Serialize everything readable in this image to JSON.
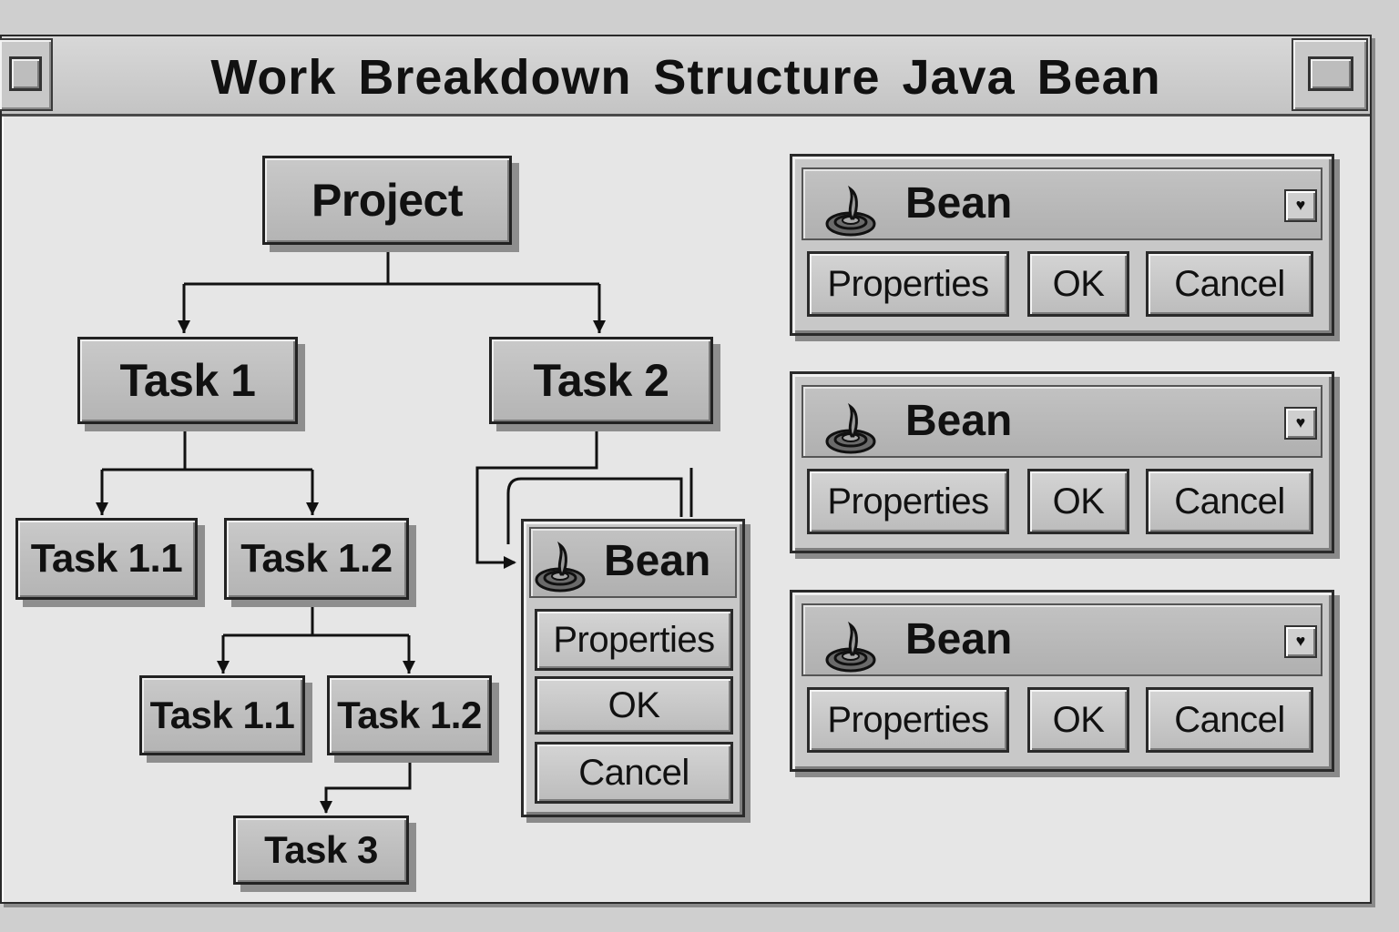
{
  "window": {
    "title": "Work Breakdown Structure Java Bean"
  },
  "tree": {
    "project": "Project",
    "task1": "Task 1",
    "task2": "Task 2",
    "task1_1": "Task 1.1",
    "task1_2": "Task 1.2",
    "task1_2_1": "Task 1.1",
    "task1_2_2": "Task 1.2",
    "task3": "Task 3"
  },
  "inline_bean": {
    "title": "Bean",
    "icon": "java-bean-icon",
    "buttons": [
      "Properties",
      "OK",
      "Cancel"
    ]
  },
  "bean_panels": [
    {
      "title": "Bean",
      "icon": "java-bean-icon",
      "dropdown_icon": "heart-dropdown-icon",
      "buttons": [
        "Properties",
        "OK",
        "Cancel"
      ]
    },
    {
      "title": "Bean",
      "icon": "java-bean-icon",
      "dropdown_icon": "heart-dropdown-icon",
      "buttons": [
        "Properties",
        "OK",
        "Cancel"
      ]
    },
    {
      "title": "Bean",
      "icon": "java-bean-icon",
      "dropdown_icon": "heart-dropdown-icon",
      "buttons": [
        "Properties",
        "OK",
        "Cancel"
      ]
    }
  ],
  "colors": {
    "background": "#e6e6e6",
    "node_fill": "#bdbdbd",
    "border": "#222222"
  }
}
